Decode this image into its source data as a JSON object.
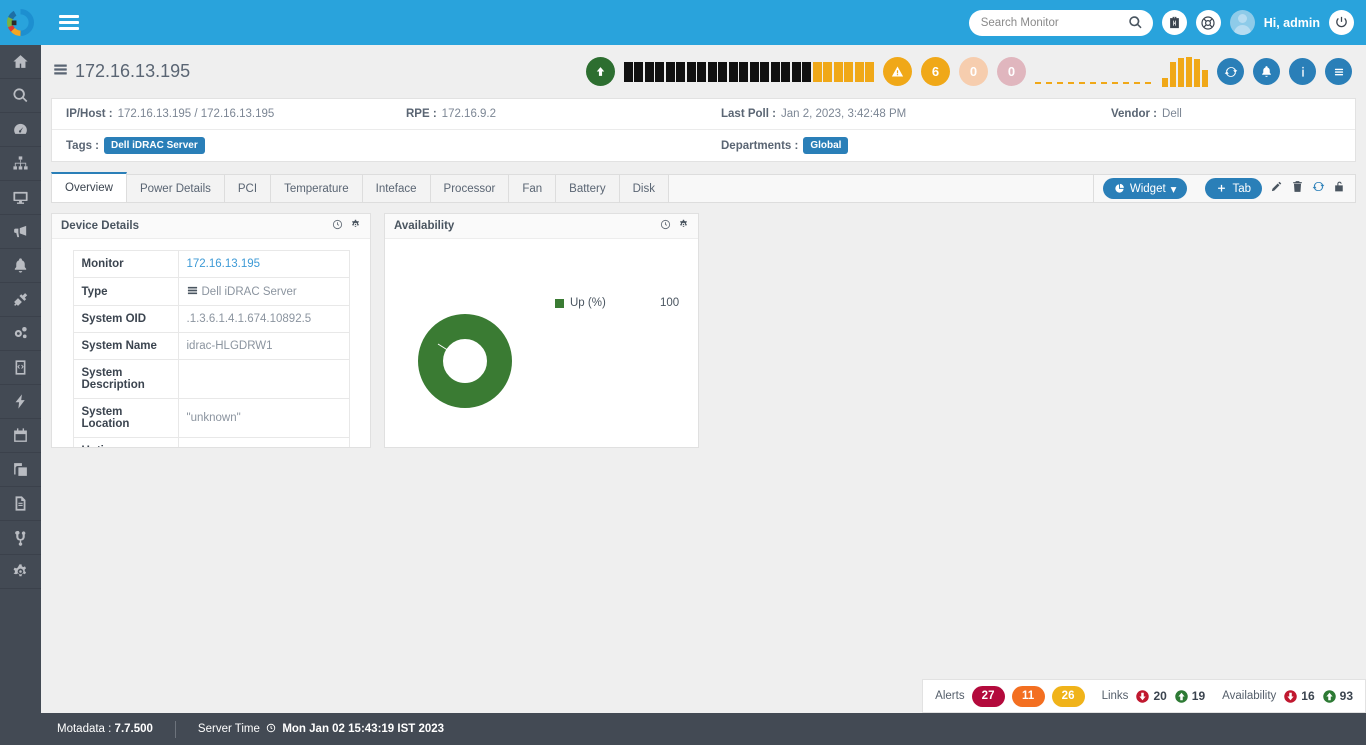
{
  "brand": {
    "logo_name": "motadata-logo",
    "topbar_color": "#29a3dc",
    "accent_blue": "#2a7fb8",
    "accent_orange": "#f0a818",
    "accent_green": "#2d6e30"
  },
  "topbar": {
    "menu_icon": "hamburger-icon",
    "search": {
      "placeholder": "Search Monitor",
      "value": "",
      "icon": "search-icon"
    },
    "briefcase_icon": "briefcase-icon",
    "lifebuoy_icon": "lifebuoy-icon",
    "avatar_icon": "user-avatar",
    "greeting": "Hi, admin",
    "power_icon": "power-icon"
  },
  "sidebar": {
    "items": [
      {
        "name": "sidebar-item-home",
        "icon": "home-icon"
      },
      {
        "name": "sidebar-item-search",
        "icon": "search-icon"
      },
      {
        "name": "sidebar-item-dashboard",
        "icon": "gauge-icon"
      },
      {
        "name": "sidebar-item-topology",
        "icon": "sitemap-icon"
      },
      {
        "name": "sidebar-item-monitors",
        "icon": "desktop-icon"
      },
      {
        "name": "sidebar-item-announcements",
        "icon": "megaphone-icon"
      },
      {
        "name": "sidebar-item-alerts",
        "icon": "bell-icon"
      },
      {
        "name": "sidebar-item-plugins",
        "icon": "plug-icon"
      },
      {
        "name": "sidebar-item-settings-gears",
        "icon": "gears-icon"
      },
      {
        "name": "sidebar-item-scripts",
        "icon": "file-code-icon"
      },
      {
        "name": "sidebar-item-automation",
        "icon": "bolt-icon"
      },
      {
        "name": "sidebar-item-scheduler",
        "icon": "calendar-icon"
      },
      {
        "name": "sidebar-item-inventory",
        "icon": "copy-icon"
      },
      {
        "name": "sidebar-item-reports",
        "icon": "document-icon"
      },
      {
        "name": "sidebar-item-workflow",
        "icon": "branch-icon"
      },
      {
        "name": "sidebar-item-admin-settings",
        "icon": "gear-icon"
      }
    ]
  },
  "device_header": {
    "icon": "server-rack-icon",
    "title": "172.16.13.195",
    "status_icon": "arrow-up-circle-icon",
    "segment_bar": {
      "filled_color": "#111111",
      "tail_color": "#f0a818",
      "filled_count": 18,
      "tail_count": 6
    },
    "badges": [
      {
        "name": "warning-badge",
        "label": "",
        "icon": "warning-triangle-icon",
        "color": "#f0a818"
      },
      {
        "name": "major-badge",
        "label": "6",
        "color": "#f0a818"
      },
      {
        "name": "minor-badge",
        "label": "0",
        "color": "#f6cdae"
      },
      {
        "name": "critical-badge",
        "label": "0",
        "color": "#e0b6be"
      }
    ],
    "sparkline": {
      "values": [
        30,
        82,
        95,
        100,
        92,
        55
      ],
      "color": "#f0a818"
    },
    "actions": [
      {
        "name": "refresh-button",
        "icon": "refresh-icon"
      },
      {
        "name": "alerts-button",
        "icon": "bell-icon"
      },
      {
        "name": "info-button",
        "icon": "info-icon"
      },
      {
        "name": "menu-button",
        "icon": "list-menu-icon"
      }
    ]
  },
  "info": {
    "ip_host_label": "IP/Host :",
    "ip_host_value": "172.16.13.195 / 172.16.13.195",
    "rpe_label": "RPE :",
    "rpe_value": "172.16.9.2",
    "last_poll_label": "Last Poll :",
    "last_poll_value": "Jan 2, 2023, 3:42:48 PM",
    "vendor_label": "Vendor :",
    "vendor_value": "Dell",
    "tags_label": "Tags :",
    "tags_value": "Dell iDRAC Server",
    "departments_label": "Departments :",
    "departments_value": "Global"
  },
  "tabs": {
    "items": [
      {
        "label": "Overview",
        "active": true
      },
      {
        "label": "Power Details",
        "active": false
      },
      {
        "label": "PCI",
        "active": false
      },
      {
        "label": "Temperature",
        "active": false
      },
      {
        "label": "Inteface",
        "active": false
      },
      {
        "label": "Processor",
        "active": false
      },
      {
        "label": "Fan",
        "active": false
      },
      {
        "label": "Battery",
        "active": false
      },
      {
        "label": "Disk",
        "active": false
      }
    ],
    "widget_button": "Widget",
    "widget_caret": "▾",
    "tab_button": "Tab",
    "tools": [
      {
        "name": "edit-icon"
      },
      {
        "name": "delete-icon"
      },
      {
        "name": "refresh-icon"
      },
      {
        "name": "unlock-icon"
      }
    ]
  },
  "device_details": {
    "title": "Device Details",
    "clock_icon": "clock-icon",
    "gear_icon": "gear-icon",
    "rows": [
      {
        "key": "Monitor",
        "value": "172.16.13.195",
        "style": "link"
      },
      {
        "key": "Type",
        "value": "Dell iDRAC Server",
        "style": "icon-text"
      },
      {
        "key": "System OID",
        "value": ".1.3.6.1.4.1.674.10892.5",
        "style": "text"
      },
      {
        "key": "System Name",
        "value": "idrac-HLGDRW1",
        "style": "text"
      },
      {
        "key": "System Description",
        "value": "",
        "style": "text"
      },
      {
        "key": "System Location",
        "value": "\"unknown\"",
        "style": "text"
      },
      {
        "key": "Uptime",
        "value": "",
        "style": "text"
      }
    ]
  },
  "availability": {
    "title": "Availability",
    "clock_icon": "clock-icon",
    "gear_icon": "gear-icon"
  },
  "chart_data": {
    "type": "pie",
    "title": "Availability",
    "variant": "donut",
    "labels": [
      "Up (%)"
    ],
    "values": [
      100
    ],
    "colors": [
      "#3a7b33"
    ],
    "legend_position": "right",
    "legend_entries": [
      {
        "name": "Up (%)",
        "value": "100",
        "color": "#3a7b33"
      }
    ]
  },
  "status_bar": {
    "alerts_label": "Alerts",
    "alerts": [
      {
        "value": "27",
        "color": "#b30a3c"
      },
      {
        "value": "11",
        "color": "#f36f21"
      },
      {
        "value": "26",
        "color": "#f0b31a"
      }
    ],
    "links_label": "Links",
    "links_down": "20",
    "links_up": "19",
    "availability_label": "Availability",
    "availability_down": "16",
    "availability_up": "93"
  },
  "footer": {
    "product_label": "Motadata : ",
    "product_version": "7.7.500",
    "server_time_label": "Server Time",
    "clock_icon": "clock-icon",
    "server_time_value": "Mon Jan 02 15:43:19 IST 2023"
  }
}
